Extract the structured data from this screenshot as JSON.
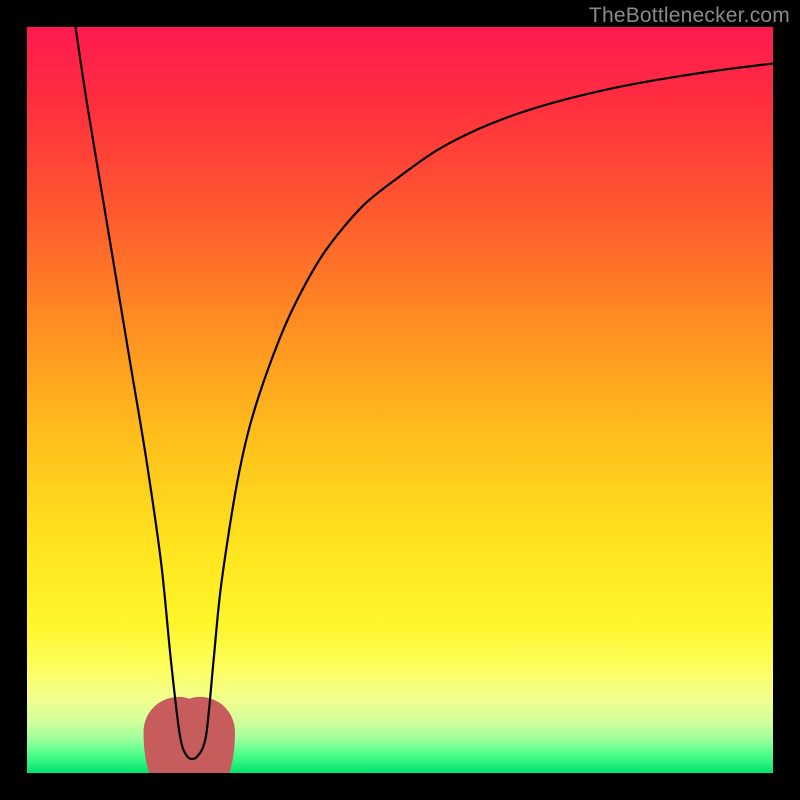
{
  "watermark": "TheBottlenecker.com",
  "chart_data": {
    "type": "line",
    "title": "",
    "xlabel": "",
    "ylabel": "",
    "xlim": [
      0,
      100
    ],
    "ylim": [
      0,
      100
    ],
    "background_gradient_stops": [
      {
        "pos": 0.0,
        "color": "#ff1a50"
      },
      {
        "pos": 0.1,
        "color": "#ff2e3f"
      },
      {
        "pos": 0.25,
        "color": "#ff5a2e"
      },
      {
        "pos": 0.4,
        "color": "#ff8e22"
      },
      {
        "pos": 0.55,
        "color": "#ffbf1c"
      },
      {
        "pos": 0.7,
        "color": "#ffe51f"
      },
      {
        "pos": 0.8,
        "color": "#fff62a"
      },
      {
        "pos": 0.86,
        "color": "#fdff60"
      },
      {
        "pos": 0.9,
        "color": "#f2ff8e"
      },
      {
        "pos": 0.93,
        "color": "#d4ff9a"
      },
      {
        "pos": 0.955,
        "color": "#9cff9c"
      },
      {
        "pos": 0.975,
        "color": "#4eff8a"
      },
      {
        "pos": 1.0,
        "color": "#00e56e"
      }
    ],
    "series": [
      {
        "name": "bottleneck-curve",
        "x": [
          6.5,
          8,
          10,
          12,
          14,
          16,
          18,
          19.3,
          20.5,
          21.5,
          22.8,
          24,
          25,
          26,
          28,
          30,
          33,
          36,
          40,
          45,
          50,
          55,
          60,
          65,
          70,
          75,
          80,
          85,
          90,
          95,
          100
        ],
        "y": [
          100,
          90,
          78,
          66,
          54,
          42,
          28,
          15,
          5,
          2.2,
          2.2,
          5,
          15,
          25,
          38,
          47,
          56,
          63,
          70,
          76,
          80,
          83.5,
          86.1,
          88.1,
          89.7,
          91,
          92.1,
          93,
          93.8,
          94.5,
          95.1
        ]
      }
    ],
    "marker": {
      "name": "min-point-marker",
      "color": "#c65c5c",
      "x_range": [
        20.3,
        23.2
      ],
      "y_center": 2.4,
      "thickness": 2.6
    }
  }
}
